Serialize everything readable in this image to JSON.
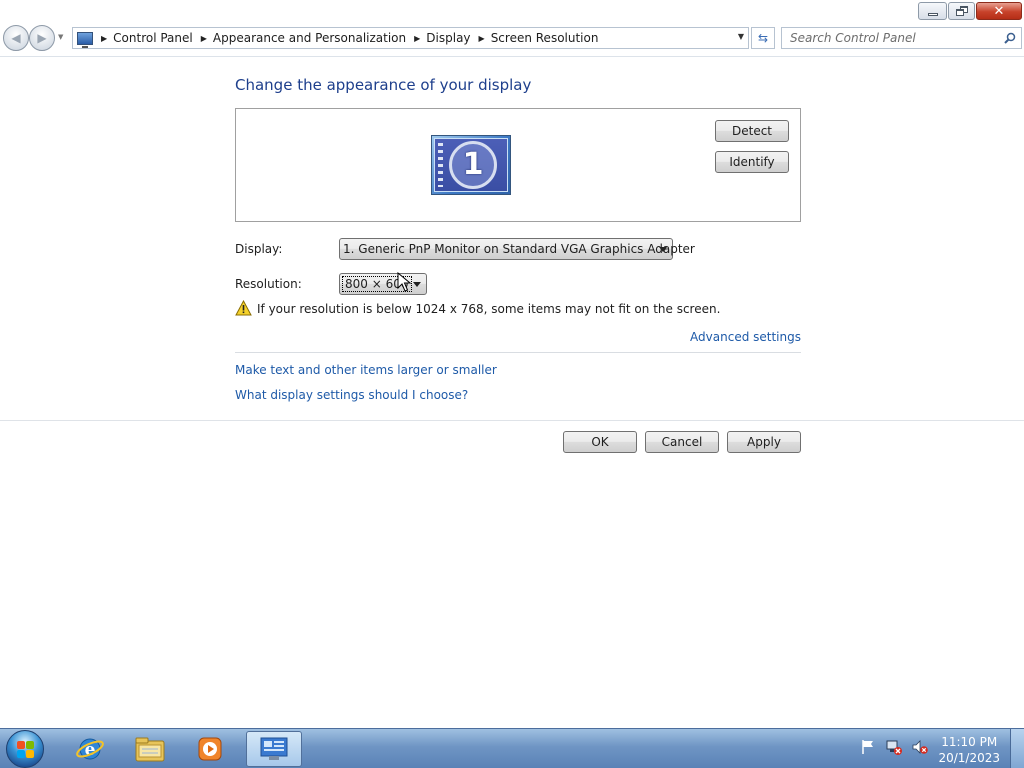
{
  "window": {
    "caption_buttons": [
      "minimize",
      "maximize",
      "close"
    ]
  },
  "navigation": {
    "breadcrumbs": [
      "Control Panel",
      "Appearance and Personalization",
      "Display",
      "Screen Resolution"
    ],
    "search_placeholder": "Search Control Panel"
  },
  "content": {
    "title": "Change the appearance of your display",
    "monitor_number": "1",
    "detect_label": "Detect",
    "identify_label": "Identify",
    "display_label": "Display:",
    "display_value": "1. Generic PnP Monitor on Standard VGA Graphics Adapter",
    "resolution_label": "Resolution:",
    "resolution_value": "800 × 600",
    "warning_text": "If your resolution is below 1024 x 768, some items may not fit on the screen.",
    "advanced_link": "Advanced settings",
    "link_text_size": "Make text and other items larger or smaller",
    "link_display_help": "What display settings should I choose?"
  },
  "footer": {
    "ok_label": "OK",
    "cancel_label": "Cancel",
    "apply_label": "Apply"
  },
  "taskbar": {
    "pinned": [
      "internet-explorer-icon",
      "windows-explorer-icon",
      "media-player-icon",
      "display-settings-icon"
    ],
    "time": "11:10 PM",
    "date": "20/1/2023"
  },
  "colors": {
    "title_blue": "#1e3f8c",
    "link_blue": "#1e5aa8",
    "close_red": "#c7422a",
    "taskbar_blue": "#6f95c4"
  }
}
